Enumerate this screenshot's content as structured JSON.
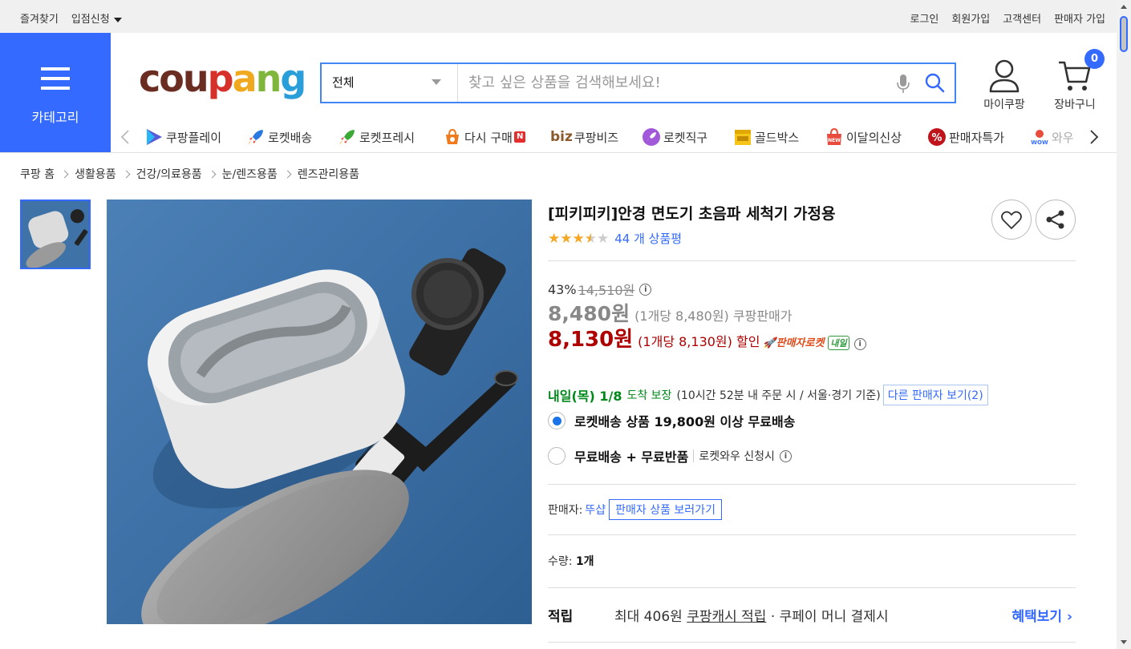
{
  "topbar": {
    "bookmark": "즐겨찾기",
    "apply": "입점신청",
    "login": "로그인",
    "signup": "회원가입",
    "support": "고객센터",
    "seller_signup": "판매자 가입"
  },
  "header": {
    "category_label": "카테고리",
    "logo": {
      "c1": "cou",
      "c2": "p",
      "c3": "a",
      "c4": "n",
      "c5": "g"
    },
    "search_category": "전체",
    "search_placeholder": "찾고 싶은 상품을 검색해보세요!",
    "mycoupang": "마이쿠팡",
    "cart": "장바구니",
    "cart_count": "0"
  },
  "services": [
    {
      "label": "쿠팡플레이",
      "icon": "play-icon"
    },
    {
      "label": "로켓배송",
      "icon": "rocket-icon"
    },
    {
      "label": "로켓프레시",
      "icon": "rocket-fresh-icon"
    },
    {
      "label": "다시 구매",
      "icon": "rebuy-icon",
      "badge": "N"
    },
    {
      "label": "쿠팡비즈",
      "icon": "biz-icon",
      "prefix": "biz"
    },
    {
      "label": "로켓직구",
      "icon": "rocket-global-icon"
    },
    {
      "label": "골드박스",
      "icon": "goldbox-icon"
    },
    {
      "label": "이달의신상",
      "icon": "new-icon"
    },
    {
      "label": "판매자특가",
      "icon": "seller-deal-icon"
    },
    {
      "label": "와우",
      "icon": "wow-icon"
    }
  ],
  "breadcrumb": [
    "쿠팡 홈",
    "생활용품",
    "건강/의료용품",
    "눈/렌즈용품",
    "렌즈관리용품"
  ],
  "product": {
    "title": "[피키피키]안경 면도기 초음파 세척기 가정용",
    "rating": 3.5,
    "review_count": "44 개 상품평",
    "discount_rate": "43%",
    "original_price": "14,510원",
    "price1": "8,480원",
    "price1_unit": "(1개당 8,480원) 쿠팡판매가",
    "price2": "8,130원",
    "price2_unit": "(1개당 8,130원) 할인",
    "rocket_seller": "판매자로켓",
    "tomorrow_badge": "내일",
    "arrival_date": "내일(목) 1/8",
    "arrival_guarantee": "도착 보장",
    "arrival_note": "(10시간 52분 내 주문 시 / 서울·경기 기준)",
    "other_sellers": "다른 판매자 보기(2)",
    "option1": "로켓배송 상품 19,800원 이상 무료배송",
    "option2": "무료배송 + 무료반품",
    "option2_sub": "로켓와우 신청시",
    "seller_label": "판매자:",
    "seller_name": "뚜샵",
    "seller_link": "판매자 상품 보러가기",
    "qty_label": "수량:",
    "qty_value": "1개",
    "points_label": "적립",
    "points_text1": "최대 406원",
    "points_link": "쿠팡캐시 적립",
    "points_text2": "· 쿠페이 머니 결제시",
    "points_more": "혜택보기 ›"
  },
  "colors": {
    "brand_blue": "#346aff",
    "price_red": "#ae0000",
    "arrival_green": "#00891a"
  }
}
